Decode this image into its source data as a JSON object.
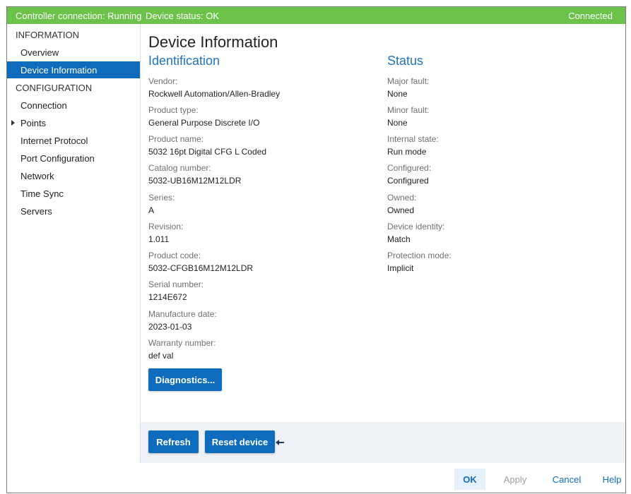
{
  "status_bar": {
    "controller_connection": "Controller connection: Running",
    "device_status": "Device status: OK",
    "connection_state": "Connected"
  },
  "sidebar": {
    "information_header": "INFORMATION",
    "overview": "Overview",
    "device_information": "Device Information",
    "configuration_header": "CONFIGURATION",
    "connection": "Connection",
    "points": "Points",
    "internet_protocol": "Internet Protocol",
    "port_configuration": "Port Configuration",
    "network": "Network",
    "time_sync": "Time Sync",
    "servers": "Servers"
  },
  "main": {
    "page_title": "Device Information",
    "identification": {
      "title": "Identification",
      "fields": [
        {
          "label": "Vendor:",
          "value": "Rockwell Automation/Allen-Bradley"
        },
        {
          "label": "Product type:",
          "value": "General Purpose Discrete I/O"
        },
        {
          "label": "Product name:",
          "value": "5032 16pt Digital CFG L Coded"
        },
        {
          "label": "Catalog number:",
          "value": "5032-UB16M12M12LDR"
        },
        {
          "label": "Series:",
          "value": "A"
        },
        {
          "label": "Revision:",
          "value": "1.011"
        },
        {
          "label": "Product code:",
          "value": "5032-CFGB16M12M12LDR"
        },
        {
          "label": "Serial number:",
          "value": "1214E672"
        },
        {
          "label": "Manufacture date:",
          "value": "2023-01-03"
        },
        {
          "label": "Warranty number:",
          "value": "def val"
        }
      ]
    },
    "status": {
      "title": "Status",
      "fields": [
        {
          "label": "Major fault:",
          "value": "None"
        },
        {
          "label": "Minor fault:",
          "value": "None"
        },
        {
          "label": "Internal state:",
          "value": "Run mode"
        },
        {
          "label": "Configured:",
          "value": "Configured"
        },
        {
          "label": "Owned:",
          "value": "Owned"
        },
        {
          "label": "Device identity:",
          "value": "Match"
        },
        {
          "label": "Protection mode:",
          "value": "Implicit"
        }
      ]
    },
    "diagnostics_button": "Diagnostics..."
  },
  "action_bar": {
    "refresh": "Refresh",
    "reset_device": "Reset device",
    "arrow_icon": "left-arrow-icon"
  },
  "footer": {
    "ok": "OK",
    "apply": "Apply",
    "cancel": "Cancel",
    "help": "Help"
  },
  "colors": {
    "status_bar": "#6cc24a",
    "accent": "#0f6cbd",
    "section_title": "#1e73be",
    "disabled_text": "#a0a0a0"
  }
}
